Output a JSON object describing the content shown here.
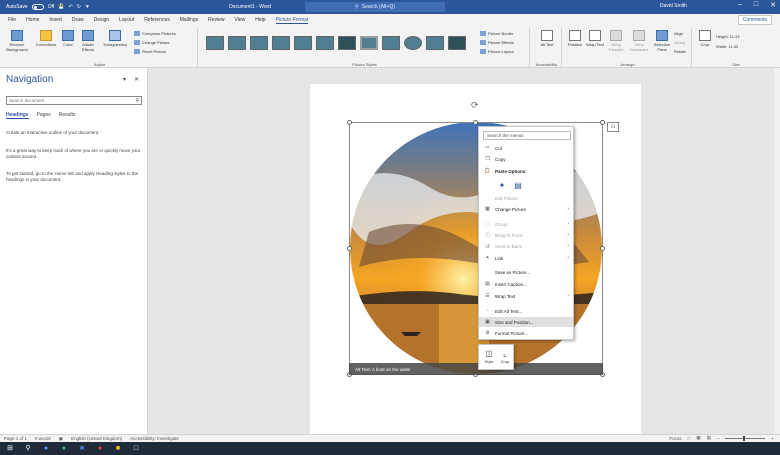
{
  "titlebar": {
    "autosave_label": "AutoSave",
    "autosave_state": "Off",
    "doc_title": "Document1 - Word",
    "search_placeholder": "Search (Alt+Q)",
    "user": "David Smith",
    "window_controls": [
      "minimize-icon",
      "restore-icon",
      "close-icon"
    ]
  },
  "tabs": [
    "File",
    "Home",
    "Insert",
    "Draw",
    "Design",
    "Layout",
    "References",
    "Mailings",
    "Review",
    "View",
    "Help",
    "Picture Format"
  ],
  "active_tab": "Picture Format",
  "comments_label": "Comments",
  "ribbon": {
    "adjust": {
      "label": "Adjust",
      "remove_bg": "Remove Background",
      "corrections": "Corrections",
      "color": "Color",
      "artistic": "Artistic Effects",
      "transparency": "Transparency",
      "compress": "Compress Pictures",
      "change": "Change Picture",
      "reset": "Reset Picture"
    },
    "styles": {
      "label": "Picture Styles",
      "border": "Picture Border",
      "effects": "Picture Effects",
      "layout": "Picture Layout"
    },
    "accessibility": {
      "label": "Accessibility",
      "alt_text": "Alt Text"
    },
    "arrange": {
      "label": "Arrange",
      "position": "Position",
      "wrap": "Wrap Text",
      "forward": "Bring Forward",
      "backward": "Send Backward",
      "selection": "Selection Pane",
      "align": "Align",
      "group": "Group",
      "rotate": "Rotate"
    },
    "size": {
      "label": "Size",
      "crop": "Crop",
      "height": "Height: 11.43",
      "width": "Width: 11.43"
    }
  },
  "nav": {
    "title": "Navigation",
    "search_placeholder": "Search document",
    "tabs": [
      "Headings",
      "Pages",
      "Results"
    ],
    "text1": "Create an interactive outline of your document.",
    "text2": "It's a great way to keep track of where you are or quickly move your content around.",
    "text3": "To get started, go to the Home tab and apply Heading styles to the headings in your document."
  },
  "picture": {
    "alt_text": "Alt Text: A boat on the water",
    "colors": {
      "sky_top": "#3f73b8",
      "cloud": "#e8edf3",
      "glow": "#f5a623",
      "sun": "#fff2a8",
      "water": "#d98a2b",
      "dark": "#2a2320"
    }
  },
  "context_menu": {
    "search": "Search the menus",
    "items": [
      {
        "label": "Cut",
        "icon": "scissors-icon",
        "state": "normal"
      },
      {
        "label": "Copy",
        "icon": "copy-icon",
        "state": "normal"
      },
      {
        "label": "Paste Options:",
        "icon": "paste-icon",
        "state": "bold"
      },
      {
        "label": "Edit Picture",
        "icon": "",
        "state": "disabled"
      },
      {
        "label": "Change Picture",
        "icon": "change-picture-icon",
        "state": "submenu"
      },
      {
        "label": "Group",
        "icon": "group-icon",
        "state": "disabled-submenu"
      },
      {
        "label": "Bring to Front",
        "icon": "bring-front-icon",
        "state": "disabled-submenu"
      },
      {
        "label": "Send to Back",
        "icon": "send-back-icon",
        "state": "disabled-submenu"
      },
      {
        "label": "Link",
        "icon": "link-icon",
        "state": "submenu"
      },
      {
        "label": "Save as Picture...",
        "icon": "",
        "state": "normal"
      },
      {
        "label": "Insert Caption...",
        "icon": "caption-icon",
        "state": "normal"
      },
      {
        "label": "Wrap Text",
        "icon": "wrap-icon",
        "state": "submenu"
      },
      {
        "label": "Edit Alt Text...",
        "icon": "alt-text-icon",
        "state": "normal"
      },
      {
        "label": "Size and Position...",
        "icon": "size-icon",
        "state": "hover"
      },
      {
        "label": "Format Picture...",
        "icon": "format-icon",
        "state": "normal"
      }
    ]
  },
  "minibar": {
    "style": "Style",
    "crop": "Crop"
  },
  "status": {
    "page": "Page 1 of 1",
    "words": "0 words",
    "language": "English (United Kingdom)",
    "accessibility": "Accessibility: Investigate",
    "focus": "Focus"
  }
}
